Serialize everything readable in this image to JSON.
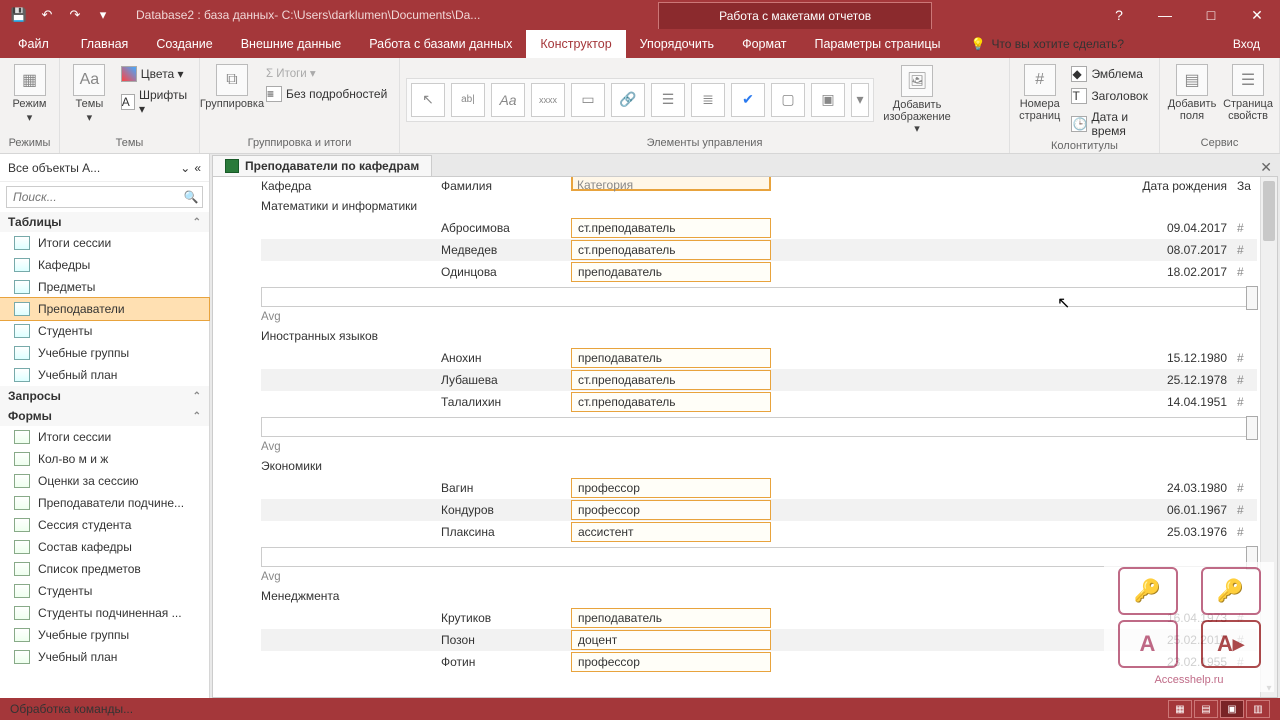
{
  "title": {
    "doc": "Database2 : база данных- C:\\Users\\darklumen\\Documents\\Da...",
    "context": "Работа с макетами отчетов"
  },
  "winbtns": {
    "help": "?",
    "min": "—",
    "max": "□",
    "close": "✕"
  },
  "qat": {
    "save": "💾",
    "undo": "↶",
    "redo": "↷",
    "more": "▾"
  },
  "tabs": {
    "file": "Файл",
    "home": "Главная",
    "create": "Создание",
    "external": "Внешние данные",
    "dbtools": "Работа с базами данных",
    "design": "Конструктор",
    "arrange": "Упорядочить",
    "format": "Формат",
    "page": "Параметры страницы",
    "tell": "Что вы хотите сделать?",
    "login": "Вход"
  },
  "ribbon": {
    "modes": {
      "label": "Режимы",
      "btn": "Режим"
    },
    "themes": {
      "label": "Темы",
      "btn": "Темы",
      "colors": "Цвета ▾",
      "fonts": "Шрифты ▾"
    },
    "grouping": {
      "label": "Группировка и итоги",
      "btn": "Группировка",
      "totals": "Σ Итоги ▾",
      "details": "Без подробностей"
    },
    "controls": {
      "label": "Элементы управления",
      "img": "Добавить изображение ▾"
    },
    "headers": {
      "label": "Колонтитулы",
      "btn": "Номера страниц",
      "logo": "Эмблема",
      "title": "Заголовок",
      "date": "Дата и время"
    },
    "service": {
      "label": "Сервис",
      "add": "Добавить поля",
      "prop": "Страница свойств"
    }
  },
  "nav": {
    "title": "Все объекты A...",
    "search": "Поиск...",
    "g_tables": "Таблицы",
    "g_queries": "Запросы",
    "g_forms": "Формы",
    "tables": [
      "Итоги сессии",
      "Кафедры",
      "Предметы",
      "Преподаватели",
      "Студенты",
      "Учебные группы",
      "Учебный план"
    ],
    "forms": [
      "Итоги сессии",
      "Кол-во м и ж",
      "Оценки за сессию",
      "Преподаватели подчине...",
      "Сессия студента",
      "Состав кафедры",
      "Список предметов",
      "Студенты",
      "Студенты подчиненная ...",
      "Учебные группы",
      "Учебный план"
    ]
  },
  "doc": {
    "tab": "Преподаватели по кафедрам"
  },
  "cols": {
    "dept": "Кафедра",
    "surname": "Фамилия",
    "cat": "Категория",
    "dob": "Дата рождения",
    "za": "За"
  },
  "avg": "Avg",
  "groups": [
    {
      "dept": "Математики и информатики",
      "rows": [
        {
          "s": "Абросимова",
          "c": "ст.преподаватель",
          "d": "09.04.2017",
          "h": "#"
        },
        {
          "s": "Медведев",
          "c": "ст.преподаватель",
          "d": "08.07.2017",
          "h": "#"
        },
        {
          "s": "Одинцова",
          "c": "преподаватель",
          "d": "18.02.2017",
          "h": "#"
        }
      ]
    },
    {
      "dept": "Иностранных языков",
      "rows": [
        {
          "s": "Анохин",
          "c": "преподаватель",
          "d": "15.12.1980",
          "h": "#"
        },
        {
          "s": "Лубашева",
          "c": "ст.преподаватель",
          "d": "25.12.1978",
          "h": "#"
        },
        {
          "s": "Талалихин",
          "c": "ст.преподаватель",
          "d": "14.04.1951",
          "h": "#"
        }
      ]
    },
    {
      "dept": "Экономики",
      "rows": [
        {
          "s": "Вагин",
          "c": "профессор",
          "d": "24.03.1980",
          "h": "#"
        },
        {
          "s": "Кондуров",
          "c": "профессор",
          "d": "06.01.1967",
          "h": "#"
        },
        {
          "s": "Плаксина",
          "c": "ассистент",
          "d": "25.03.1976",
          "h": "#"
        }
      ]
    },
    {
      "dept": "Менеджмента",
      "rows": [
        {
          "s": "Крутиков",
          "c": "преподаватель",
          "d": "16.04.1973",
          "h": "#"
        },
        {
          "s": "Позон",
          "c": "доцент",
          "d": "25.02.2017",
          "h": "#"
        },
        {
          "s": "Фотин",
          "c": "профессор",
          "d": "23.02.1955",
          "h": "#"
        }
      ]
    }
  ],
  "status": "Обработка команды...",
  "watermark": "Accesshelp.ru"
}
